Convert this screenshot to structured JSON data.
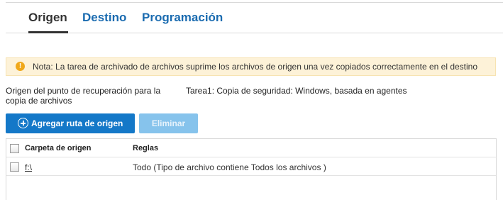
{
  "tabs": [
    {
      "label": "Origen",
      "active": true
    },
    {
      "label": "Destino",
      "active": false
    },
    {
      "label": "Programación",
      "active": false
    }
  ],
  "note": {
    "text": "Nota: La tarea de archivado de archivos suprime los archivos de origen una vez copiados correctamente en el destino",
    "icon": "warning-icon"
  },
  "recovery_point": {
    "label": "Origen del punto de recuperación para la copia de archivos",
    "value": "Tarea1: Copia de seguridad: Windows, basada en agentes"
  },
  "buttons": {
    "add_label": "Agregar ruta de origen",
    "delete_label": "Eliminar"
  },
  "table": {
    "headers": [
      "Carpeta de origen",
      "Reglas"
    ],
    "rows": [
      {
        "folder": "f:\\",
        "rules": "Todo (Tipo de archivo contiene Todos los archivos )"
      }
    ]
  },
  "colors": {
    "accent": "#1478c8",
    "tab_link": "#1a6bb0",
    "note_bg": "#fdf2d8",
    "warning": "#f0a81a",
    "disabled_button": "#86c3ec"
  }
}
